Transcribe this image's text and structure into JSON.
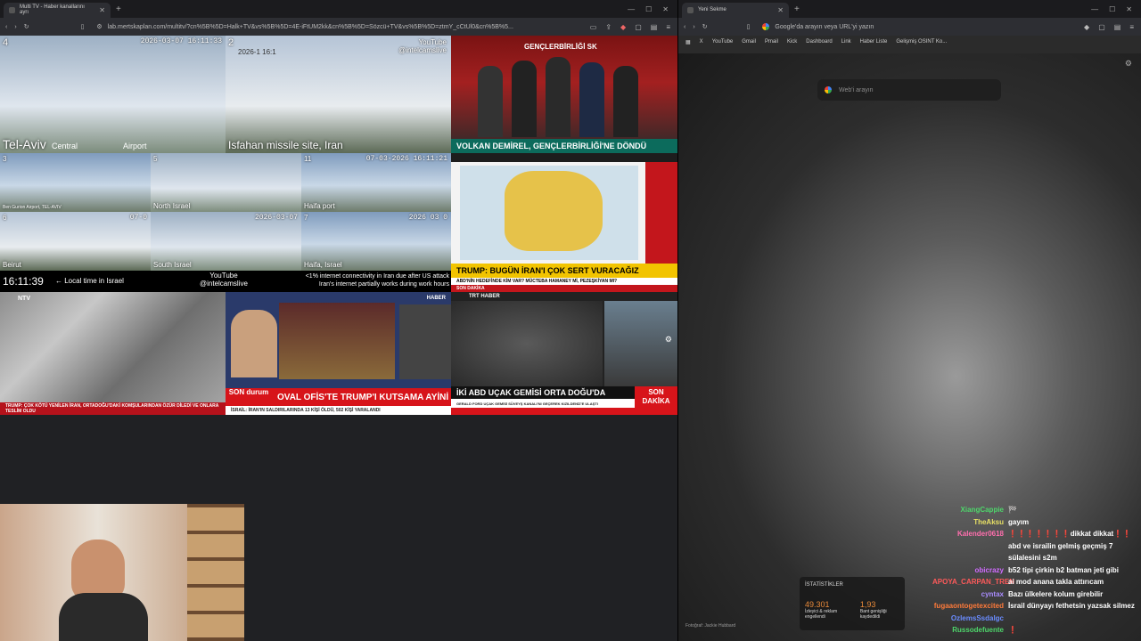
{
  "left_browser": {
    "tab_title": "Multi TV - Haber kanallarını ayrı",
    "url": "lab.mertskaplan.com/multitv/?cn%5B%5D=Halk+TV&vs%5B%5D=4E-iFtUM2kk&cn%5B%5D=Sözcü+TV&vs%5B%5D=ztmY_cCtUl0&cn%5B%5..."
  },
  "cams": {
    "c1_num": "4",
    "c1_stamp": "2026-03-07 16:11:33",
    "c1_label": "Tel-Aviv",
    "c1_sub1": "Central",
    "c1_sub2": "Airport",
    "c2_num": "2",
    "c2_stamp": "2026-1 16:1",
    "c2_yt": "YouTube",
    "c2_handle": "@intelcamslive",
    "c2_label": "Isfahan missile site, Iran",
    "c3_num": "3",
    "c3_label": "Ben Gurion Airport, TEL-AVIV",
    "c4_num": "5",
    "c4_label": "North Israel",
    "c5_num": "11",
    "c5_stamp": "07-03-2026 16:11:21",
    "c5_label": "Haifa port",
    "c6_num": "6",
    "c6_stamp": "07-0",
    "c6_label": "Beirut",
    "c7_label": "South Israel",
    "c7_stamp": "2026-03-07",
    "c8_num": "7",
    "c8_stamp": "2026 03 0",
    "c8_label": "Haifa, Israel"
  },
  "strip": {
    "clock": "16:11:39",
    "local": "← Local time in Israel",
    "yt": "YouTube",
    "handle": "@intelcamslive",
    "iran_line1": "<1% internet connectivity in Iran due after US attack",
    "iran_line2": "Iran's internet partially works during work hours"
  },
  "news": {
    "sozcu_headline": "VOLKAN DEMİREL, GENÇLERBİRLİĞİ'NE DÖNDÜ",
    "sozcu_top": "GENÇLERBİRLİĞİ SK",
    "cnn_headline": "TRUMP: BUGÜN İRAN'I ÇOK SERT VURACAĞIZ",
    "cnn_sub": "ABD'NİN HEDEFİNDE KİM VAR? MÜCTEBA HAMANEY Mİ, PEZEŞKİYAN MI?",
    "cnn_brand": "CNN TÜRK",
    "cnn_tag": "SON DAKİKA",
    "ntv_ticker": "TRUMP: ÇOK KÖTÜ YENİLEN İRAN, ORTADOĞU'DAKİ KOMŞULARINDAN ÖZÜR DİLEDİ VE ONLARA TESLİM OLDU",
    "halk_headline": "OVAL OFİS'TE TRUMP'I KUTSAMA AYİNİ",
    "halk_tag": "SON durum",
    "halk_ticker": "İSRAİL: İRAN'IN SALDIRILARINDA 13 KİŞİ ÖLDÜ, 502 KİŞİ YARALANDI",
    "trt_brand": "TRT HABER",
    "trt_headline": "İKİ ABD UÇAK GEMİSİ ORTA DOĞU'DA",
    "trt_sub": "GERALD FORD UÇAK GEMİSİ SÜVEYŞ KANALI'NI GEÇEREK KIZILDENİZ'E ULAŞTI",
    "trt_tag": "SON DAKİKA",
    "haber_tag": "HABER"
  },
  "right_browser": {
    "tab_title": "Yeni Sekme",
    "omnibox": "Google'da arayın veya URL'yi yazın",
    "search_placeholder": "Web'i arayın",
    "bookmarks": [
      "X",
      "YouTube",
      "Gmail",
      "Pmail",
      "Kick",
      "Dashboard",
      "Link",
      "Haber Liste",
      "Gelişmiş OSINT Ko..."
    ],
    "credit": "Fotoğraf: Jackie Hubbard"
  },
  "stats": {
    "title": "İSTATİSTİKLER",
    "viewers": "49.301",
    "viewers_label": "İzleyici & reklam engellendi",
    "bandwidth": "1,93",
    "bandwidth_label": "Bant genişliği kaydedildi"
  },
  "chat": [
    {
      "user": "XiangCappie",
      "color": "#4ed66b",
      "msg": "🏁"
    },
    {
      "user": "TheAksu",
      "color": "#e7e065",
      "msg": "gayım"
    },
    {
      "user": "Kalender0618",
      "color": "#ff6fae",
      "msg": "❗❗❗❗❗❗❗dikkat dikkat❗❗"
    },
    {
      "user": "",
      "color": "#ffffff",
      "msg": "abd ve israilin gelmiş geçmiş 7"
    },
    {
      "user": "",
      "color": "#ffffff",
      "msg": "sülalesini s2m"
    },
    {
      "user": "obicrazy",
      "color": "#d06bff",
      "msg": "b52 tipi çirkin b2 batman jeti gibi"
    },
    {
      "user": "APOYA_CARPAN_TREN",
      "color": "#ff5a5a",
      "msg": "ai mod anana takla attırıcam"
    },
    {
      "user": "cyntax",
      "color": "#a98cff",
      "msg": "Bazı ülkelere kolum girebilir"
    },
    {
      "user": "fugaaontogetexcited",
      "color": "#ff7a3a",
      "msg": "İsrail dünyayı fethetsin yazsak silmez"
    },
    {
      "user": "OzlemsSsdalgc",
      "color": "#6a8cff",
      "msg": ""
    },
    {
      "user": "Russodefuente",
      "color": "#4ed66b",
      "msg": "❗"
    }
  ]
}
